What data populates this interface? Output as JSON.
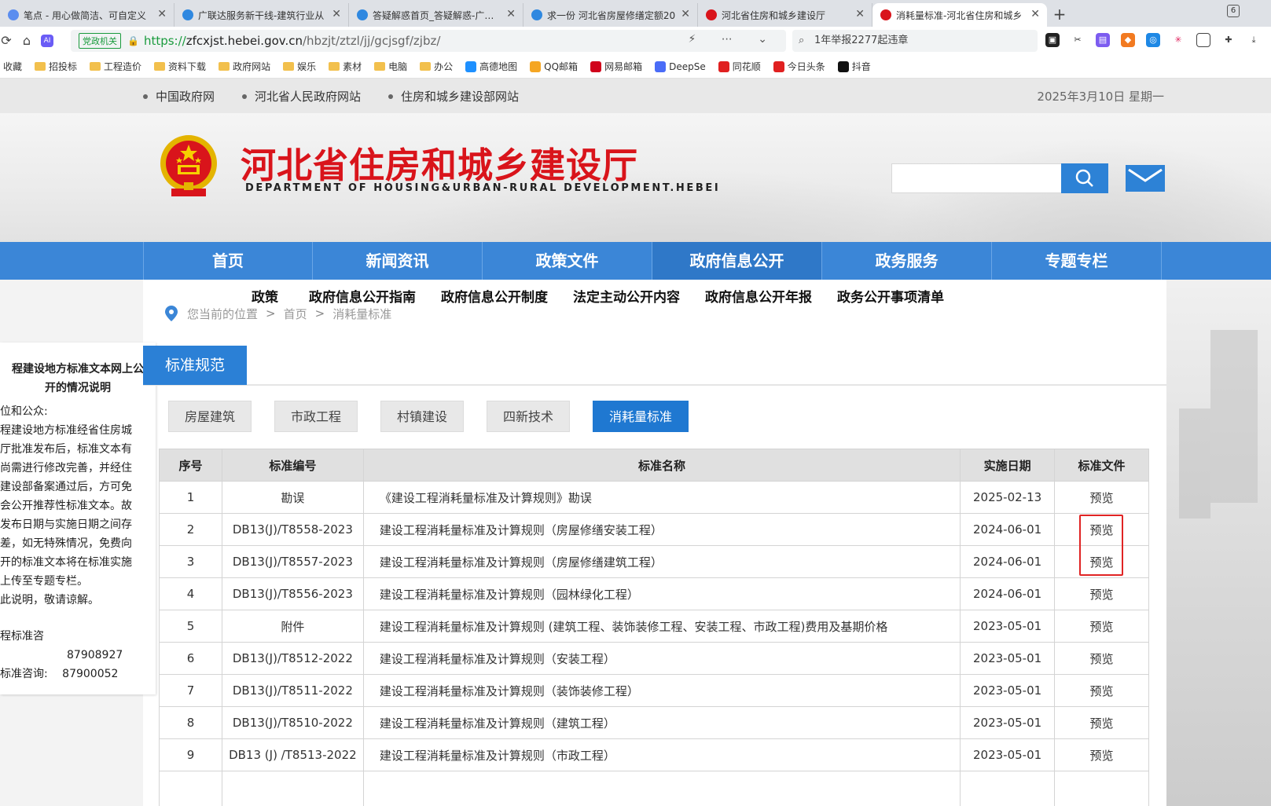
{
  "browser": {
    "tabs": [
      {
        "title": "笔点 - 用心做简洁、可自定义",
        "icon_color": "#5b8def"
      },
      {
        "title": "广联达服务新干线-建筑行业从",
        "icon_color": "#2f88e0"
      },
      {
        "title": "答疑解惑首页_答疑解惑-广联达",
        "icon_color": "#2f88e0"
      },
      {
        "title": "求一份 河北省房屋修缮定额20",
        "icon_color": "#2f88e0"
      },
      {
        "title": "河北省住房和城乡建设厅",
        "icon_color": "#d9141b"
      },
      {
        "title": "消耗量标准-河北省住房和城乡",
        "icon_color": "#d9141b",
        "active": true
      }
    ],
    "tab_count": "6",
    "new_tab": "+",
    "close_glyph": "✕",
    "gov_badge": "党政机关",
    "url_scheme": "https://",
    "url_host": "zfcxjst.hebei.gov.cn",
    "url_path": "/hbzjt/ztzl/jj/gcjsgf/zjbz/",
    "search_text": "1年举报2277起违章",
    "bookmarks": [
      {
        "label": "收藏",
        "type": "folder"
      },
      {
        "label": "招投标",
        "type": "folder"
      },
      {
        "label": "工程造价",
        "type": "folder"
      },
      {
        "label": "资料下载",
        "type": "folder"
      },
      {
        "label": "政府网站",
        "type": "folder"
      },
      {
        "label": "娱乐",
        "type": "folder"
      },
      {
        "label": "素材",
        "type": "folder"
      },
      {
        "label": "电脑",
        "type": "folder"
      },
      {
        "label": "办公",
        "type": "folder"
      },
      {
        "label": "高德地图",
        "type": "site",
        "color": "#1e90ff"
      },
      {
        "label": "QQ邮箱",
        "type": "site",
        "color": "#f5a623"
      },
      {
        "label": "网易邮箱",
        "type": "site",
        "color": "#d0021b"
      },
      {
        "label": "DeepSe",
        "type": "site",
        "color": "#4a6cf7"
      },
      {
        "label": "同花顺",
        "type": "site",
        "color": "#e02020"
      },
      {
        "label": "今日头条",
        "type": "site",
        "color": "#e02020"
      },
      {
        "label": "抖音",
        "type": "site",
        "color": "#111111"
      }
    ]
  },
  "site": {
    "top_links": [
      "中国政府网",
      "河北省人民政府网站",
      "住房和城乡建设部网站"
    ],
    "date": "2025年3月10日 星期一",
    "title": "河北省住房和城乡建设厅",
    "subtitle": "DEPARTMENT OF HOUSING&URBAN-RURAL DEVELOPMENT.HEBEI",
    "nav": [
      "首页",
      "新闻资讯",
      "政策文件",
      "政府信息公开",
      "政务服务",
      "专题专栏"
    ],
    "nav_active_index": 3,
    "subnav": [
      "政策",
      "政府信息公开指南",
      "政府信息公开制度",
      "法定主动公开内容",
      "政府信息公开年报",
      "政务公开事项清单"
    ],
    "breadcrumb": {
      "here": "您当前的位置",
      "sep": ">",
      "home": "首页",
      "current": "消耗量标准"
    },
    "left_panel": {
      "title_lines": [
        "程建设地方标准文本网上公",
        "开的情况说明"
      ],
      "body_lines": [
        "位和公众:",
        "程建设地方标准经省住房城",
        "厅批准发布后，标准文本有",
        "尚需进行修改完善，并经住",
        "建设部备案通过后，方可免",
        "会公开推荐性标准文本。故",
        "发布日期与实施日期之间存",
        "差，如无特殊情况，免费向",
        "开的标准文本将在标准实施",
        "上传至专题专栏。",
        "此说明，敬请谅解。"
      ],
      "contact_line1": "程标准咨",
      "phone1": "87908927",
      "contact_label2": "标准咨询:",
      "phone2": "87900052"
    },
    "section_title": "标准规范",
    "categories": [
      "房屋建筑",
      "市政工程",
      "村镇建设",
      "四新技术",
      "消耗量标准"
    ],
    "category_active_index": 4,
    "table": {
      "headers": [
        "序号",
        "标准编号",
        "标准名称",
        "实施日期",
        "标准文件"
      ],
      "rows": [
        [
          "1",
          "勘误",
          "《建设工程消耗量标准及计算规则》勘误",
          "2025-02-13",
          "预览"
        ],
        [
          "2",
          "DB13(J)/T8558-2023",
          "建设工程消耗量标准及计算规则（房屋修缮安装工程）",
          "2024-06-01",
          "预览"
        ],
        [
          "3",
          "DB13(J)/T8557-2023",
          "建设工程消耗量标准及计算规则（房屋修缮建筑工程）",
          "2024-06-01",
          "预览"
        ],
        [
          "4",
          "DB13(J)/T8556-2023",
          "建设工程消耗量标准及计算规则（园林绿化工程）",
          "2024-06-01",
          "预览"
        ],
        [
          "5",
          "附件",
          "建设工程消耗量标准及计算规则 (建筑工程、装饰装修工程、安装工程、市政工程)费用及基期价格",
          "2023-05-01",
          "预览"
        ],
        [
          "6",
          "DB13(J)/T8512-2022",
          "建设工程消耗量标准及计算规则（安装工程）",
          "2023-05-01",
          "预览"
        ],
        [
          "7",
          "DB13(J)/T8511-2022",
          "建设工程消耗量标准及计算规则（装饰装修工程）",
          "2023-05-01",
          "预览"
        ],
        [
          "8",
          "DB13(J)/T8510-2022",
          "建设工程消耗量标准及计算规则（建筑工程）",
          "2023-05-01",
          "预览"
        ],
        [
          "9",
          "DB13 (J) /T8513-2022",
          "建设工程消耗量标准及计算规则（市政工程）",
          "2023-05-01",
          "预览"
        ]
      ]
    },
    "colors": {
      "brand_red": "#d9141b",
      "nav_blue": "#3b86d7",
      "highlight": "#e02424"
    }
  }
}
